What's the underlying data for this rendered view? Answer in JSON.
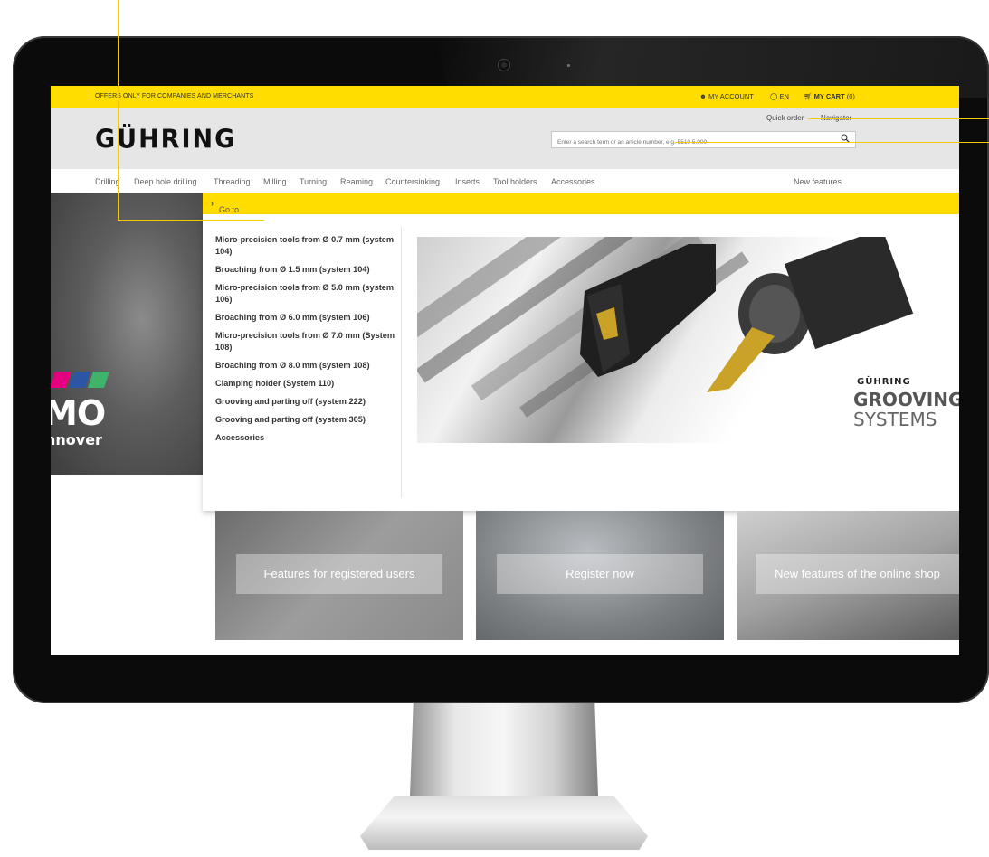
{
  "topbar": {
    "offers": "OFFERS ONLY FOR COMPANIES AND MERCHANTS",
    "account": "MY ACCOUNT",
    "language": "EN",
    "cart_label": "MY CART",
    "cart_count": "(0)"
  },
  "header": {
    "logo": "GÜHRING",
    "quick_order": "Quick order",
    "navigator": "Navigator",
    "search_placeholder": "Enter a search term or an article number, e.g. 5510 5.000"
  },
  "nav": {
    "items": [
      "Drilling",
      "Deep hole drilling",
      "Threading",
      "Milling",
      "Turning",
      "Reaming",
      "Countersinking",
      "Inserts",
      "Tool holders",
      "Accessories"
    ],
    "new_features": "New features"
  },
  "category_bar": "Go to category Turning",
  "dropdown": {
    "items": [
      "Micro-precision tools from Ø 0.7 mm (system 104)",
      "Broaching from Ø 1.5 mm (system 104)",
      "Micro-precision tools from Ø 5.0 mm (system 106)",
      "Broaching from Ø 6.0 mm (system 106)",
      "Micro-precision tools from Ø 7.0 mm (System 108)",
      "Broaching from Ø 8.0 mm (system 108)",
      "Clamping holder (System 110)",
      "Grooving and parting off (system 222)",
      "Grooving and parting off (system 305)",
      "Accessories"
    ],
    "promo": {
      "brand": "GÜHRING",
      "line1": "GROOVING",
      "line2": "SYSTEMS"
    }
  },
  "hero": {
    "emo_text": "MO",
    "emo_sub": "nnover"
  },
  "tiles": [
    {
      "label": "Features for registered users"
    },
    {
      "label": "Register now"
    },
    {
      "label": "New features of the online shop"
    }
  ],
  "colors": {
    "accent_yellow": "#ffdd00",
    "header_gray": "#e6e6e6"
  }
}
